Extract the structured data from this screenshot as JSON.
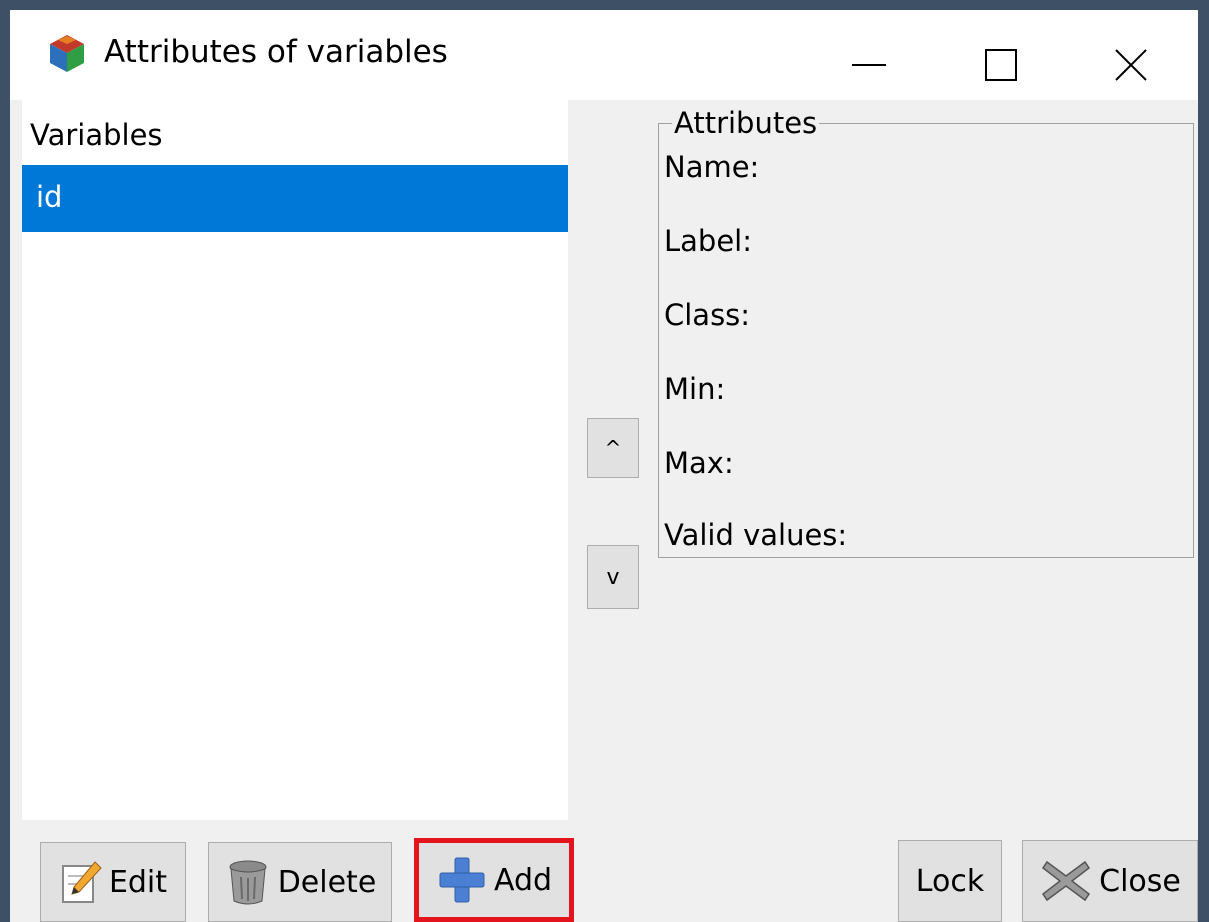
{
  "window": {
    "title": "Attributes of variables"
  },
  "variables": {
    "header": "Variables",
    "items": [
      "id"
    ]
  },
  "attributes": {
    "legend": "Attributes",
    "labels": {
      "name": "Name:",
      "label": "Label:",
      "class": "Class:",
      "min": "Min:",
      "max": "Max:",
      "valid_values": "Valid values:"
    }
  },
  "reorder": {
    "up_label": "^",
    "down_label": "v"
  },
  "buttons": {
    "edit": "Edit",
    "delete": "Delete",
    "add": "Add",
    "lock": "Lock",
    "close": "Close"
  },
  "icons": {
    "app": "tk-cube-icon",
    "edit": "pencil-icon",
    "delete": "trash-can-icon",
    "add": "plus-icon",
    "close": "x-mark-icon"
  },
  "colors": {
    "selection": "#0078d7",
    "highlight_border": "#e3141e",
    "add_icon": "#4a7fd4"
  }
}
